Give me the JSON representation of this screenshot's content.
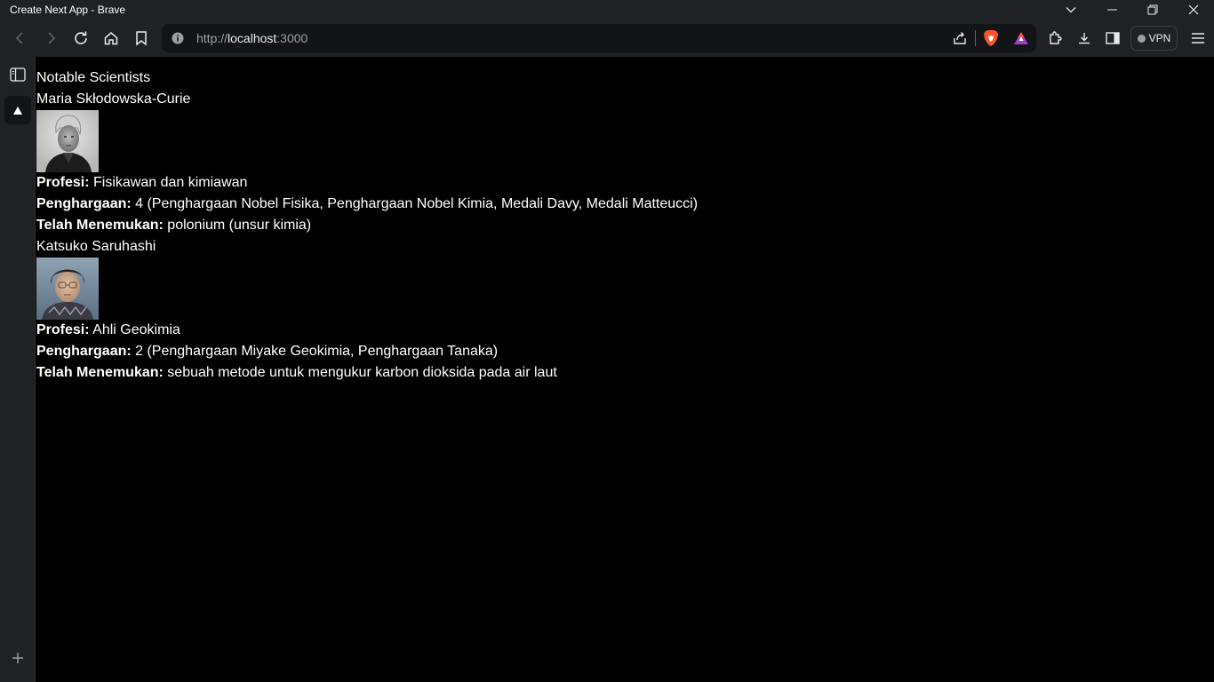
{
  "window": {
    "title": "Create Next App - Brave"
  },
  "toolbar": {
    "back": "back-icon",
    "forward": "forward-icon",
    "reload": "reload-icon",
    "home": "home-icon",
    "bookmark": "bookmark-icon"
  },
  "address_bar": {
    "protocol": "http://",
    "host": "localhost",
    "port": ":3000"
  },
  "vpn": {
    "label": "VPN"
  },
  "page": {
    "heading": "Notable Scientists",
    "scientists": [
      {
        "name": "Maria Skłodowska-Curie",
        "profession_label": "Profesi:",
        "profession": " Fisikawan dan kimiawan",
        "awards_label": "Penghargaan:",
        "awards": " 4 (Penghargaan Nobel Fisika, Penghargaan Nobel Kimia, Medali Davy, Medali Matteucci)",
        "discovered_label": "Telah Menemukan:",
        "discovered": " polonium (unsur kimia)"
      },
      {
        "name": "Katsuko Saruhashi",
        "profession_label": "Profesi:",
        "profession": " Ahli Geokimia",
        "awards_label": "Penghargaan:",
        "awards": " 2 (Penghargaan Miyake Geokimia, Penghargaan Tanaka)",
        "discovered_label": "Telah Menemukan:",
        "discovered": " sebuah metode untuk mengukur karbon dioksida pada air laut"
      }
    ]
  }
}
